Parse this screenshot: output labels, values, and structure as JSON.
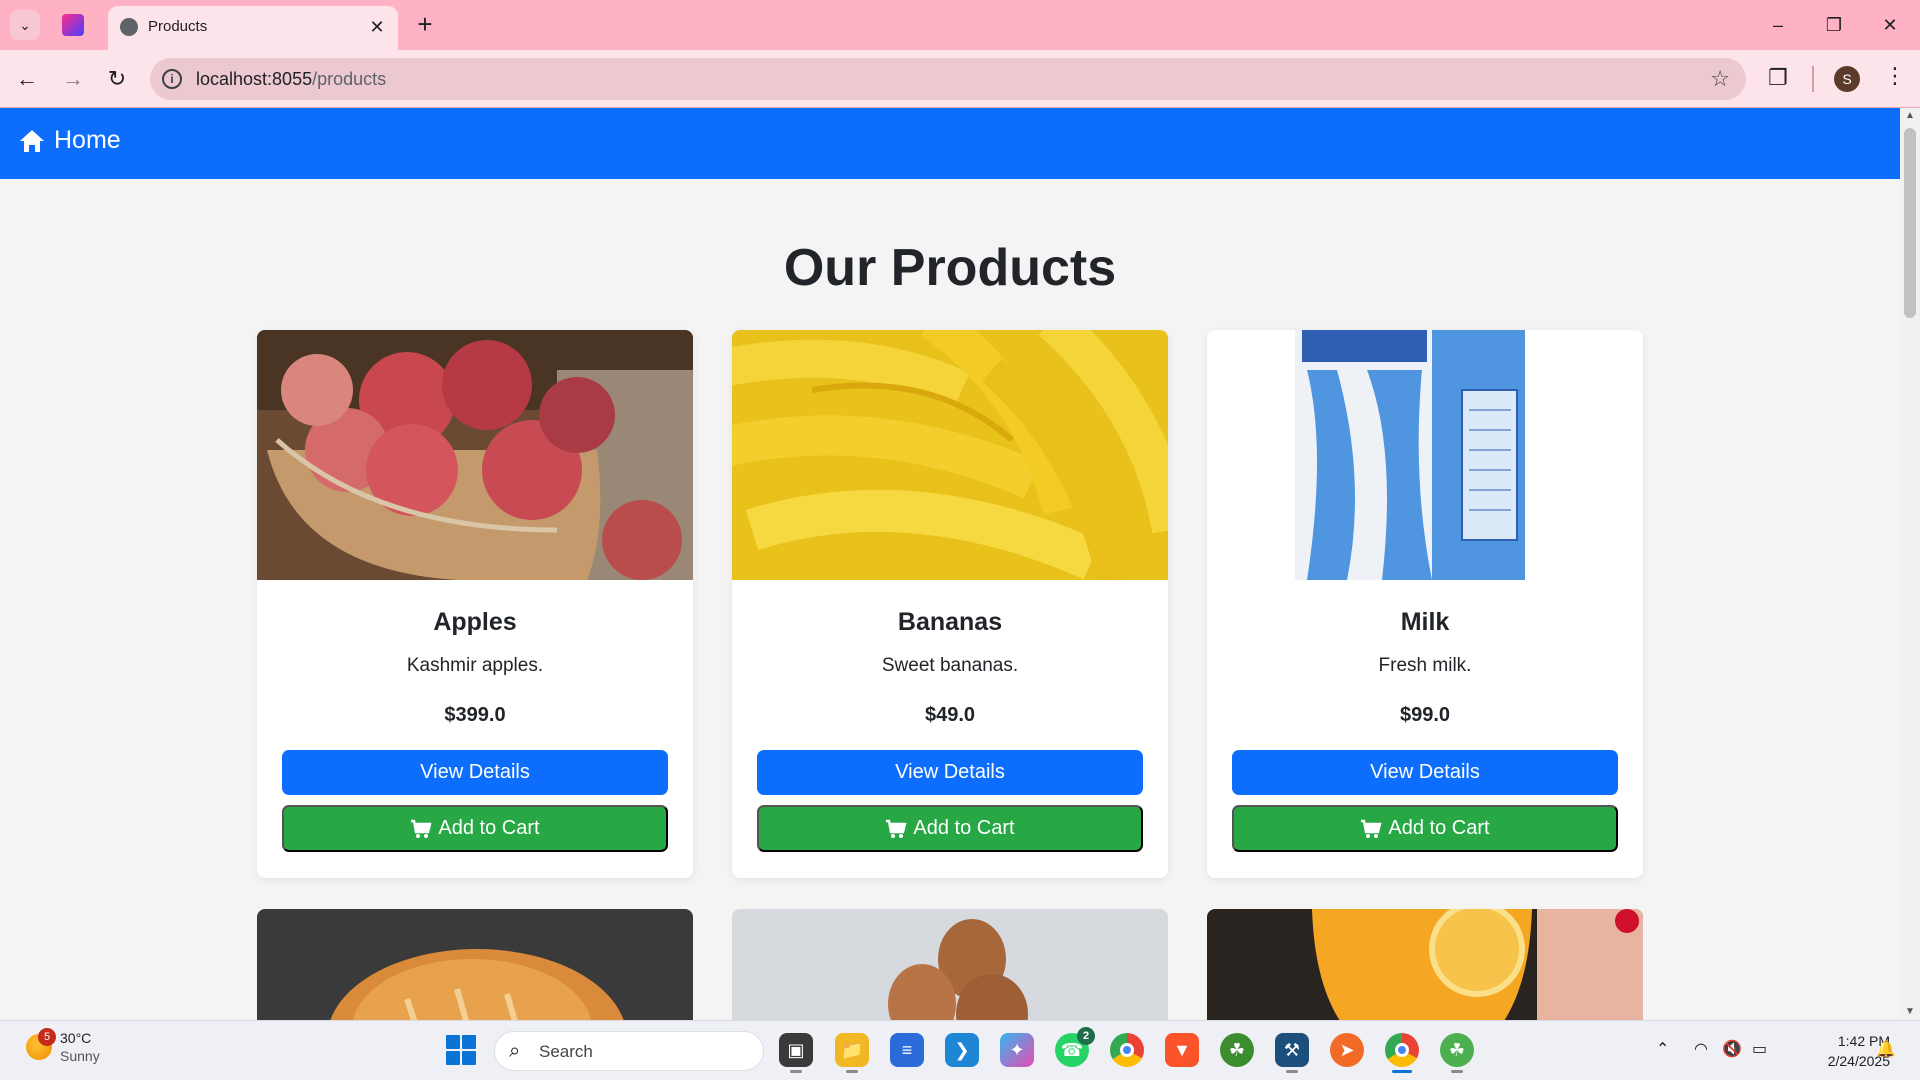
{
  "browser": {
    "tab_title": "Products",
    "url_host": "localhost:8055",
    "url_path": "/products",
    "profile_initial": "S"
  },
  "navbar": {
    "home_label": "Home"
  },
  "page": {
    "title": "Our Products"
  },
  "products": [
    {
      "name": "Apples",
      "description": "Kashmir apples.",
      "price": "$399.0",
      "details_label": "View Details",
      "cart_label": "Add to Cart"
    },
    {
      "name": "Bananas",
      "description": "Sweet bananas.",
      "price": "$49.0",
      "details_label": "View Details",
      "cart_label": "Add to Cart"
    },
    {
      "name": "Milk",
      "description": "Fresh milk.",
      "price": "$99.0",
      "details_label": "View Details",
      "cart_label": "Add to Cart"
    }
  ],
  "taskbar": {
    "weather_temp": "30°C",
    "weather_condition": "Sunny",
    "weather_badge": "5",
    "search_placeholder": "Search",
    "whatsapp_badge": "2",
    "time": "1:42 PM",
    "date": "2/24/2025"
  },
  "colors": {
    "navbar": "#0d6efd",
    "details_button": "#0d6efd",
    "cart_button": "#28a745",
    "tabstrip": "#ffb2c3"
  }
}
